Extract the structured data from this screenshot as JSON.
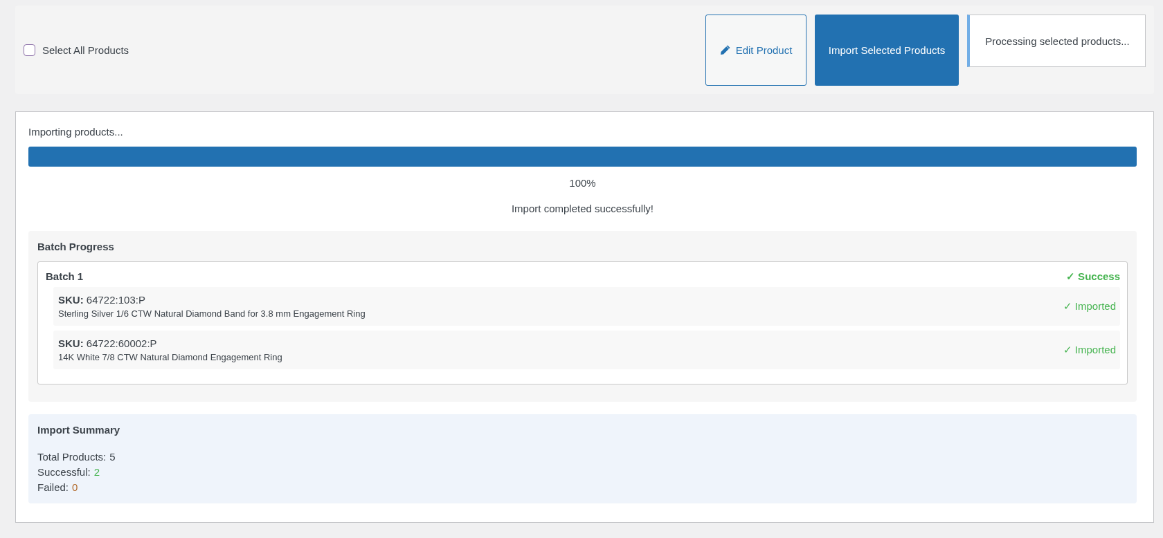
{
  "toolbar": {
    "select_all": {
      "label": "Select All Products",
      "checked": false
    },
    "edit_button": "Edit Product",
    "import_button": "Import Selected Products",
    "notice": "Processing selected products..."
  },
  "progress": {
    "heading": "Importing products...",
    "level": 1,
    "percent": "100%",
    "message": "Import completed successfully!"
  },
  "batch_progress": {
    "title": "Batch Progress",
    "batches": [
      {
        "name": "Batch 1",
        "status": "✓ Success",
        "items": [
          {
            "sku_label": "SKU:",
            "sku": "64722:103:P",
            "name": "Sterling Silver 1/6 CTW Natural Diamond Band for 3.8 mm Engagement Ring",
            "status": "✓ Imported"
          },
          {
            "sku_label": "SKU:",
            "sku": "64722:60002:P",
            "name": "14K White 7/8 CTW Natural Diamond Engagement Ring",
            "status": "✓ Imported"
          }
        ]
      }
    ]
  },
  "summary": {
    "title": "Import Summary",
    "stats": [
      {
        "label": "Total Products:",
        "value": "5"
      },
      {
        "label": "Successful:",
        "value": "2",
        "color": "#46b450"
      },
      {
        "label": "Failed:",
        "value": "0",
        "color": "#b26b2c"
      }
    ]
  }
}
